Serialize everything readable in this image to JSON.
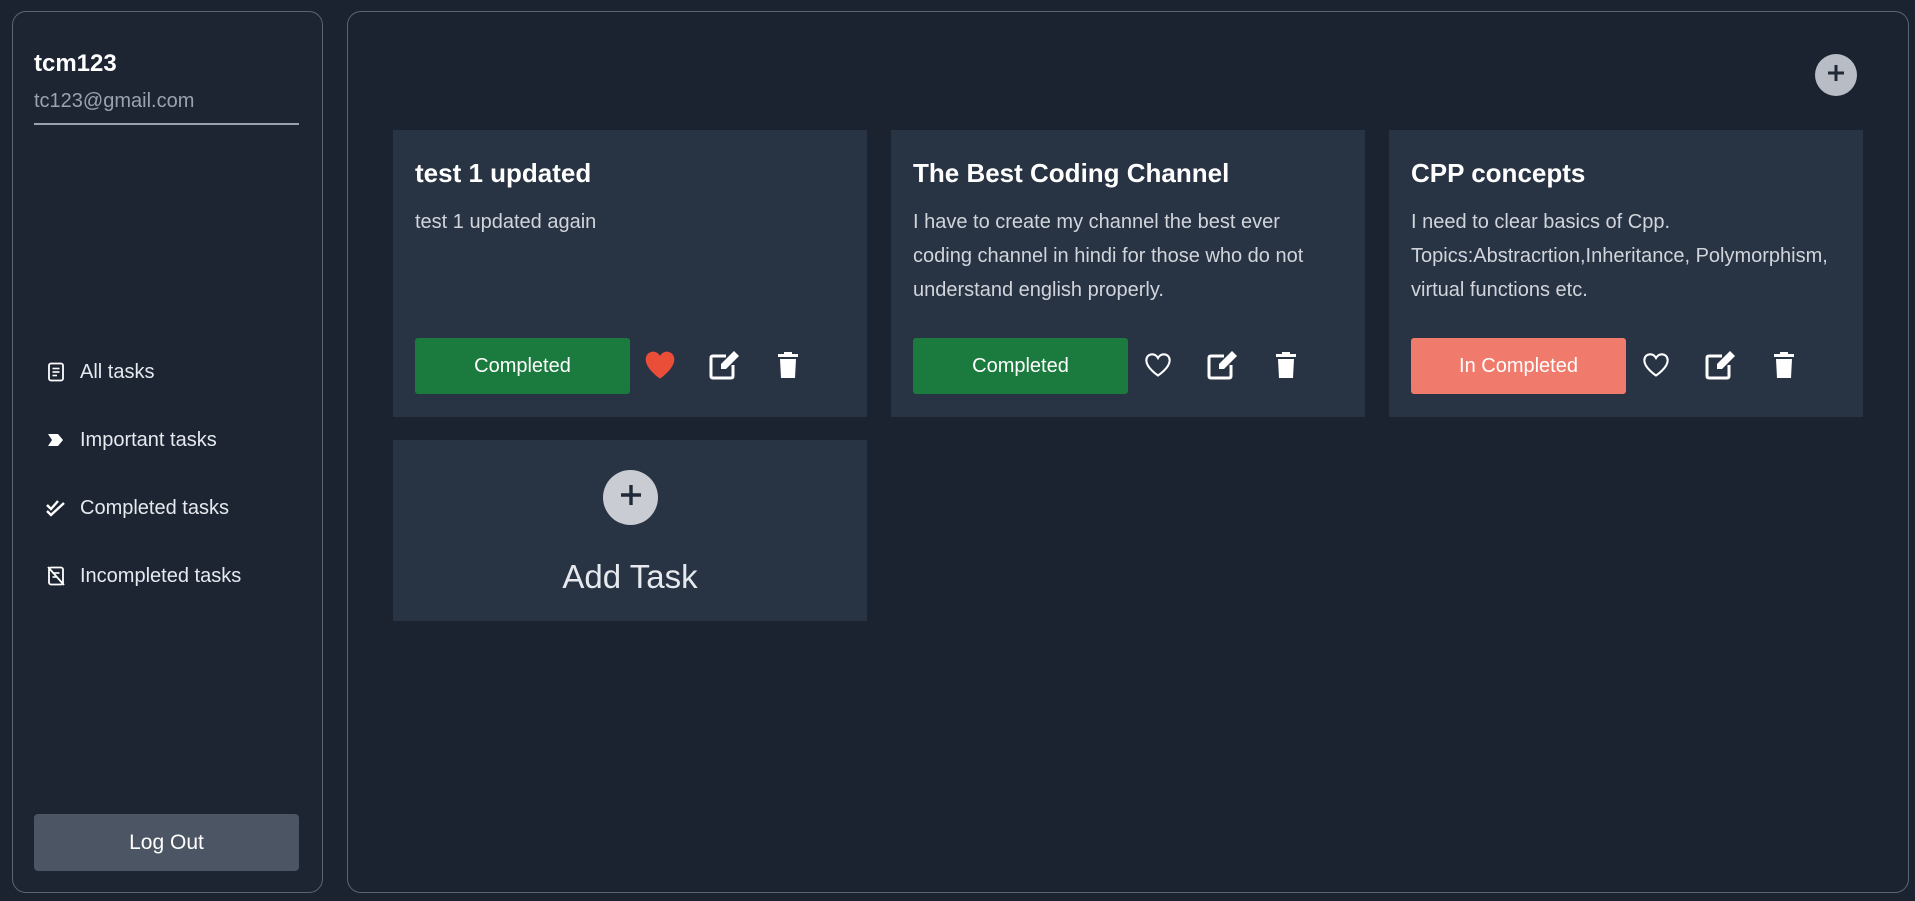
{
  "user": {
    "name": "tcm123",
    "email": "tc123@gmail.com"
  },
  "nav": [
    {
      "label": "All tasks",
      "icon": "notes-icon"
    },
    {
      "label": "Important tasks",
      "icon": "label-icon"
    },
    {
      "label": "Completed tasks",
      "icon": "double-check-icon"
    },
    {
      "label": "Incompleted tasks",
      "icon": "notes-off-icon"
    }
  ],
  "logout_label": "Log Out",
  "tasks": [
    {
      "title": "test 1 updated",
      "desc": "test 1 updated again",
      "status": "Completed",
      "status_color": "#1b7a3d",
      "important": true
    },
    {
      "title": "The Best Coding Channel",
      "desc": "I have to create my channel the best ever coding channel in hindi for those who do not understand english properly.",
      "status": "Completed",
      "status_color": "#1b7a3d",
      "important": false
    },
    {
      "title": "CPP concepts",
      "desc": "I need to clear basics of Cpp. Topics:Abstracrtion,Inheritance, Polymorphism, virtual functions etc.",
      "status": "In Completed",
      "status_color": "#f07a6c",
      "important": false
    }
  ],
  "add_task_label": "Add Task",
  "colors": {
    "heart_active": "#ea4e38",
    "icon": "#ffffff"
  }
}
